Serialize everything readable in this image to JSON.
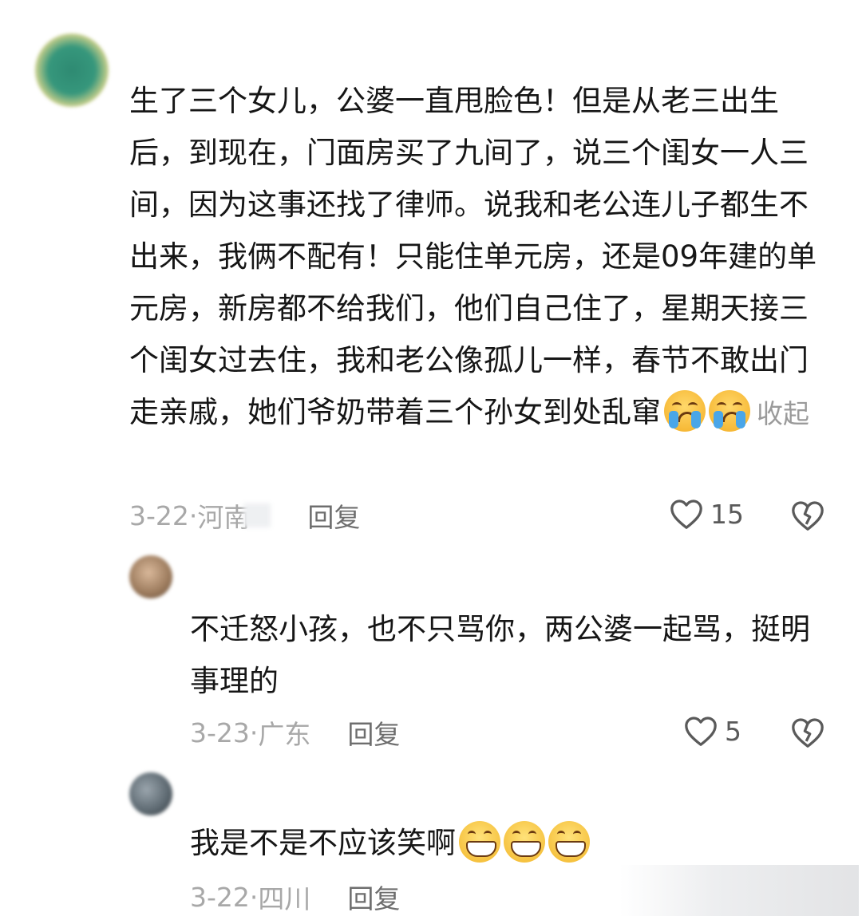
{
  "comments": [
    {
      "text": "生了三个女儿，公婆一直甩脸色！但是从老三出生后，到现在，门面房买了九间了，说三个闺女一人三间，因为这事还找了律师。说我和老公连儿子都生不出来，我俩不配有！只能住单元房，还是09年建的单元房，新房都不给我们，他们自己住了，星期天接三个闺女过去住，我和老公像孤儿一样，春节不敢出门走亲戚，她们爷奶带着三个孙女到处乱窜",
      "emojis": [
        "loudly-crying-face",
        "loudly-crying-face"
      ],
      "collapse_label": "收起",
      "date": "3-22",
      "location": "河南",
      "reply_label": "回复",
      "likes": "15"
    },
    {
      "text": "不迁怒小孩，也不只骂你，两公婆一起骂，挺明事理的",
      "date": "3-23",
      "location": "广东",
      "reply_label": "回复",
      "likes": "5"
    },
    {
      "text": "我是不是不应该笑啊",
      "emojis": [
        "grinning-face",
        "grinning-face",
        "grinning-face"
      ],
      "date": "3-22",
      "location": "四川",
      "reply_label": "回复"
    }
  ],
  "icons": {
    "like": "heart-outline-icon",
    "dislike": "broken-heart-icon"
  },
  "colors": {
    "text": "#161616",
    "meta": "#a8a8a8",
    "reply": "#6e6e6e",
    "icon": "#5a5a5a"
  }
}
